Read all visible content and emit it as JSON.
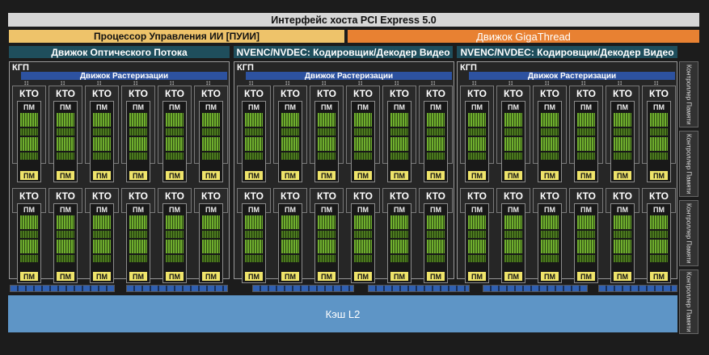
{
  "pcie": "Интерфейс хоста PCI Express 5.0",
  "ai_processor": "Процессор Управления ИИ [ПУИИ]",
  "gigathread": "Движок GigaThread",
  "engines": [
    "Движок Оптического Потока",
    "NVENC/NVDEC: Кодировщик/Декодер Видео",
    "NVENC/NVDEC: Кодировщик/Декодер Видео"
  ],
  "gpc_label": "КГП",
  "raster_label": "Движок Растеризации",
  "tpc_label": "КТО",
  "sm_label": "ПМ",
  "memory_controller": "Контроллер Памяти",
  "l2": "Кэш L2",
  "colors": {
    "pcie": "#d6d6d6",
    "ai_processor": "#eec36a",
    "gigathread": "#e88132",
    "engine": "#1f4e5c",
    "raster": "#2d52a0",
    "cores": "#6fae2e",
    "sm_tag": "#efe46a",
    "l2": "#5e95c6"
  }
}
